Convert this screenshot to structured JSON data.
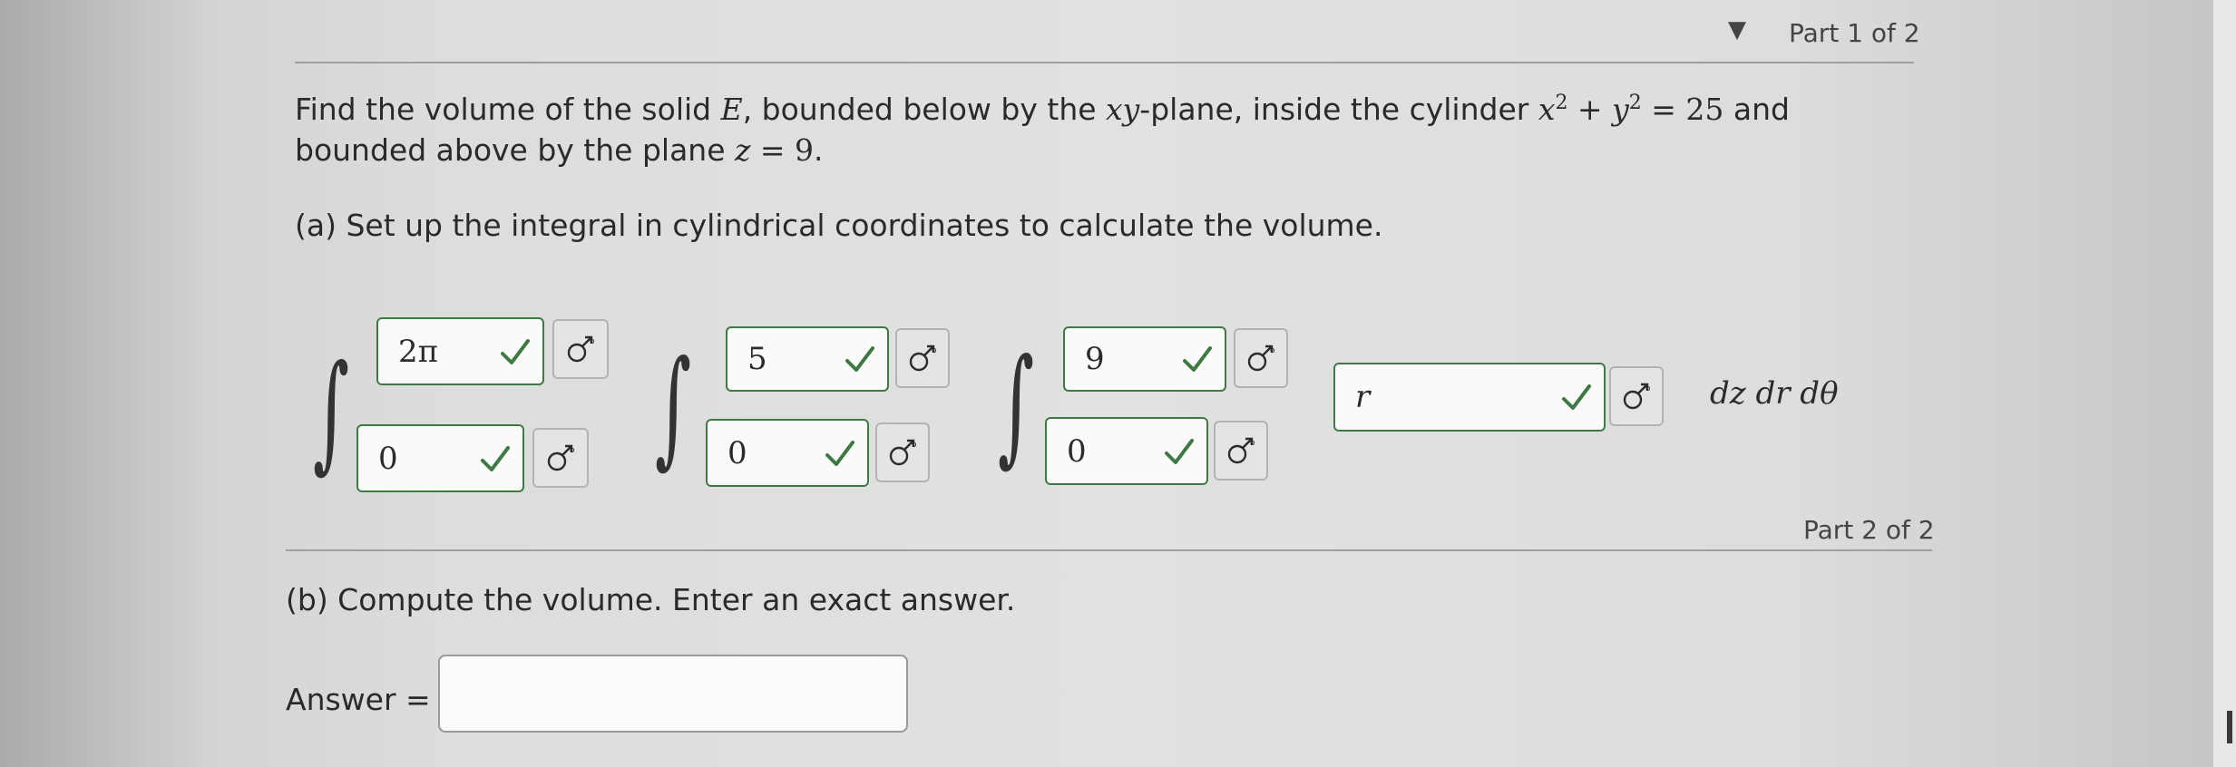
{
  "part1": {
    "header": "Part 1 of 2"
  },
  "question": {
    "line1": {
      "t1": "Find the volume of the solid ",
      "E": "E",
      "t2": ", bounded below by the ",
      "xy": "xy",
      "t3": "-plane, inside the cylinder ",
      "x": "x",
      "exp1": "2",
      "plus": " + ",
      "y": "y",
      "exp2": "2",
      "eq": " = ",
      "n25": "25",
      "t4": " and"
    },
    "line2": {
      "t1": "bounded above by the plane ",
      "z": "z",
      "eq": " = ",
      "n9": "9",
      "t2": "."
    },
    "part_a": "(a) Set up the integral in cylindrical coordinates to calculate the volume."
  },
  "integral": {
    "outer": {
      "upper": "2π",
      "lower": "0"
    },
    "middle": {
      "upper": "5",
      "lower": "0"
    },
    "inner": {
      "upper": "9",
      "lower": "0"
    },
    "integrand": "r",
    "differentials": "dz dr dθ"
  },
  "part2": {
    "header": "Part 2 of 2",
    "prompt": "(b) Compute the volume. Enter an exact answer.",
    "answer_label": "Answer =",
    "answer_value": ""
  },
  "icons": {
    "correct": "check-icon",
    "tool": "math-tool-icon"
  },
  "colors": {
    "check": "#3f7a44",
    "border_correct": "#3f7a44"
  }
}
